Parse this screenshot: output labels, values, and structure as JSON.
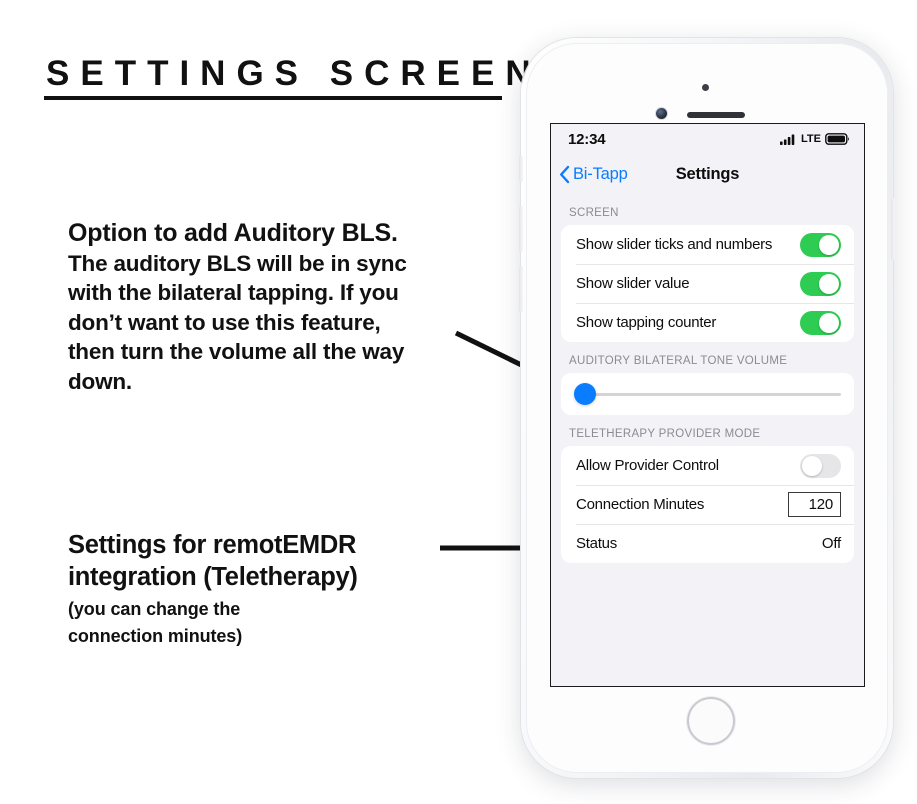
{
  "page": {
    "title": "SETTINGS SCREEN"
  },
  "annotations": {
    "auditory": {
      "heading": "Option to add Auditory BLS.",
      "line1": "The auditory BLS will be in sync",
      "line2": "with the bilateral tapping. If you",
      "line3": "don’t want to use this feature,",
      "line4": "then turn the volume all the way",
      "line5": "down."
    },
    "teletherapy": {
      "line1": "Settings for remotEMDR",
      "line2": "integration (Teletherapy)",
      "sub1": "(you can change the",
      "sub2": "connection minutes)"
    }
  },
  "phone": {
    "status_bar": {
      "time": "12:34",
      "network": "LTE",
      "signal_icon": "cellular-signal-icon",
      "battery_icon": "battery-full-icon"
    },
    "nav_bar": {
      "back_icon": "chevron-left-icon",
      "back_label": "Bi-Tapp",
      "title": "Settings"
    },
    "sections": {
      "screen": {
        "header": "SCREEN",
        "rows": [
          {
            "label": "Show slider ticks and numbers",
            "toggle": "on"
          },
          {
            "label": "Show slider value",
            "toggle": "on"
          },
          {
            "label": "Show tapping counter",
            "toggle": "on"
          }
        ]
      },
      "volume": {
        "header": "AUDITORY BILATERAL TONE VOLUME",
        "slider_value": 0,
        "slider_min": 0,
        "slider_max": 100
      },
      "teletherapy": {
        "header": "TELETHERAPY PROVIDER MODE",
        "rows": [
          {
            "label": "Allow Provider Control",
            "toggle": "off"
          },
          {
            "label": "Connection Minutes",
            "value": "120"
          },
          {
            "label": "Status",
            "value": "Off"
          }
        ]
      }
    }
  },
  "colors": {
    "toggle_on": "#2ecc52",
    "toggle_off": "#e6e6e9",
    "ios_blue": "#0a7cff",
    "screen_bg": "#f2f2f7",
    "card_bg": "#ffffff",
    "text_primary": "#0d0d0d",
    "text_secondary": "#8b8b90",
    "page_bg": "#ffffff",
    "ink": "#111111"
  }
}
